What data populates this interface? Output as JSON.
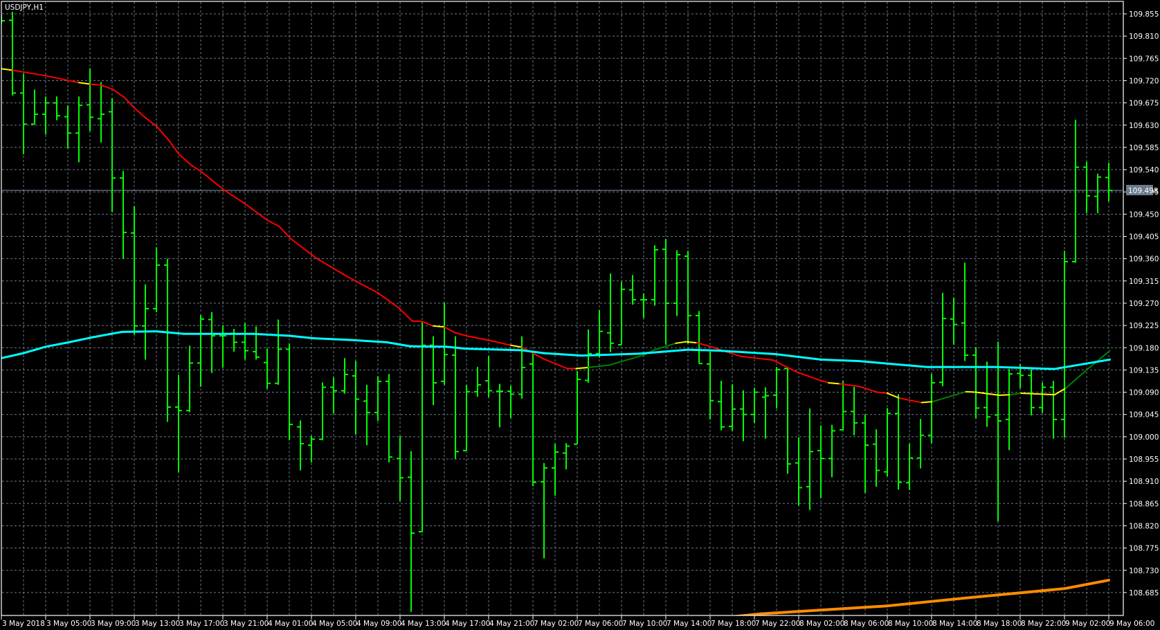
{
  "chart_data": {
    "type": "ohlc",
    "title": "USDJPY,H1",
    "symbol": "USDJPY",
    "timeframe": "H1",
    "current_price": "109.498",
    "ylim": [
      108.64,
      109.88
    ],
    "grid": true,
    "price_labels": [
      "109.855",
      "109.810",
      "109.765",
      "109.720",
      "109.675",
      "109.630",
      "109.585",
      "109.540",
      "109.495",
      "109.450",
      "109.405",
      "109.360",
      "109.315",
      "109.270",
      "109.225",
      "109.180",
      "109.135",
      "109.090",
      "109.045",
      "109.000",
      "108.955",
      "108.910",
      "108.865",
      "108.820",
      "108.775",
      "108.730",
      "108.685"
    ],
    "time_labels": [
      "3 May 2018",
      "3 May 05:00",
      "3 May 09:00",
      "3 May 13:00",
      "3 May 17:00",
      "3 May 21:00",
      "4 May 01:00",
      "4 May 05:00",
      "4 May 09:00",
      "4 May 13:00",
      "4 May 17:00",
      "4 May 21:00",
      "7 May 02:00",
      "7 May 06:00",
      "7 May 10:00",
      "7 May 14:00",
      "7 May 18:00",
      "7 May 22:00",
      "8 May 02:00",
      "8 May 06:00",
      "8 May 10:00",
      "8 May 14:00",
      "8 May 18:00",
      "8 May 22:00",
      "9 May 02:00",
      "9 May 06:00"
    ],
    "bars_ohlc": [
      [
        109.845,
        109.852,
        109.835,
        109.841
      ],
      [
        109.842,
        109.859,
        109.69,
        109.695
      ],
      [
        109.695,
        109.734,
        109.571,
        109.632
      ],
      [
        109.632,
        109.702,
        109.631,
        109.652
      ],
      [
        109.652,
        109.688,
        109.611,
        109.675
      ],
      [
        109.675,
        109.688,
        109.64,
        109.649
      ],
      [
        109.647,
        109.67,
        109.583,
        109.614
      ],
      [
        109.614,
        109.688,
        109.555,
        109.67
      ],
      [
        109.671,
        109.745,
        109.618,
        109.646
      ],
      [
        109.643,
        109.717,
        109.595,
        109.652
      ],
      [
        109.657,
        109.684,
        109.454,
        109.523
      ],
      [
        109.523,
        109.537,
        109.36,
        109.413
      ],
      [
        109.412,
        109.466,
        109.207,
        109.224
      ],
      [
        109.224,
        109.308,
        109.156,
        109.259
      ],
      [
        109.259,
        109.383,
        109.252,
        109.347
      ],
      [
        109.347,
        109.36,
        109.03,
        109.06
      ],
      [
        109.06,
        109.125,
        108.929,
        109.053
      ],
      [
        109.053,
        109.184,
        109.05,
        109.149
      ],
      [
        109.149,
        109.246,
        109.101,
        109.238
      ],
      [
        109.237,
        109.252,
        109.129,
        109.204
      ],
      [
        109.204,
        109.225,
        109.14,
        109.204
      ],
      [
        109.209,
        109.218,
        109.172,
        109.191
      ],
      [
        109.191,
        109.23,
        109.156,
        109.174
      ],
      [
        109.172,
        109.223,
        109.156,
        109.161
      ],
      [
        109.15,
        109.178,
        109.097,
        109.108
      ],
      [
        109.108,
        109.237,
        109.105,
        109.177
      ],
      [
        109.177,
        109.188,
        108.993,
        109.025
      ],
      [
        109.02,
        109.033,
        108.932,
        108.986
      ],
      [
        108.983,
        109.002,
        108.948,
        108.995
      ],
      [
        108.995,
        109.11,
        108.993,
        109.1
      ],
      [
        109.1,
        109.12,
        109.047,
        109.093
      ],
      [
        109.093,
        109.159,
        109.087,
        109.126
      ],
      [
        109.123,
        109.153,
        109.005,
        109.076
      ],
      [
        109.072,
        109.105,
        108.983,
        109.049
      ],
      [
        109.049,
        109.122,
        109.032,
        109.112
      ],
      [
        109.112,
        109.127,
        108.948,
        108.959
      ],
      [
        108.956,
        109.001,
        108.87,
        108.917
      ],
      [
        108.918,
        108.971,
        108.646,
        108.805
      ],
      [
        108.808,
        109.231,
        108.807,
        109.185
      ],
      [
        109.185,
        109.203,
        109.064,
        109.109
      ],
      [
        109.112,
        109.271,
        109.105,
        109.166
      ],
      [
        109.165,
        109.203,
        108.955,
        108.97
      ],
      [
        108.972,
        109.105,
        108.972,
        109.091
      ],
      [
        109.091,
        109.141,
        109.081,
        109.105
      ],
      [
        109.113,
        109.163,
        109.08,
        109.093
      ],
      [
        109.092,
        109.107,
        109.019,
        109.092
      ],
      [
        109.092,
        109.103,
        109.038,
        109.086
      ],
      [
        109.086,
        109.203,
        109.077,
        109.14
      ],
      [
        109.147,
        109.169,
        108.9,
        108.908
      ],
      [
        108.909,
        108.947,
        108.754,
        108.937
      ],
      [
        108.937,
        108.986,
        108.881,
        108.969
      ],
      [
        108.967,
        108.987,
        108.934,
        108.981
      ],
      [
        108.985,
        109.133,
        108.985,
        109.116
      ],
      [
        109.114,
        109.217,
        109.109,
        109.168
      ],
      [
        109.168,
        109.256,
        109.16,
        109.213
      ],
      [
        109.21,
        109.33,
        109.171,
        109.189
      ],
      [
        109.186,
        109.313,
        109.186,
        109.298
      ],
      [
        109.297,
        109.327,
        109.267,
        109.277
      ],
      [
        109.277,
        109.289,
        109.24,
        109.277
      ],
      [
        109.277,
        109.387,
        109.265,
        109.378
      ],
      [
        109.379,
        109.4,
        109.186,
        109.27
      ],
      [
        109.27,
        109.377,
        109.244,
        109.368
      ],
      [
        109.365,
        109.376,
        109.188,
        109.245
      ],
      [
        109.245,
        109.254,
        109.148,
        109.148
      ],
      [
        109.147,
        109.172,
        109.035,
        109.073
      ],
      [
        109.071,
        109.113,
        109.013,
        109.02
      ],
      [
        109.021,
        109.106,
        109.012,
        109.056
      ],
      [
        109.056,
        109.094,
        108.991,
        109.045
      ],
      [
        109.045,
        109.099,
        109.028,
        109.09
      ],
      [
        109.08,
        109.1,
        108.996,
        109.083
      ],
      [
        109.084,
        109.141,
        109.057,
        109.136
      ],
      [
        109.138,
        109.138,
        108.925,
        108.945
      ],
      [
        108.947,
        108.999,
        108.861,
        108.897
      ],
      [
        108.899,
        109.057,
        108.852,
        108.97
      ],
      [
        108.972,
        109.023,
        108.876,
        108.956
      ],
      [
        108.956,
        109.024,
        108.918,
        109.012
      ],
      [
        109.014,
        109.113,
        109.013,
        109.051
      ],
      [
        109.051,
        109.101,
        109.003,
        109.028
      ],
      [
        109.028,
        109.045,
        108.887,
        108.983
      ],
      [
        108.985,
        109.015,
        108.899,
        108.932
      ],
      [
        108.929,
        109.058,
        108.92,
        109.047
      ],
      [
        109.047,
        109.086,
        108.893,
        108.908
      ],
      [
        108.907,
        108.986,
        108.892,
        108.957
      ],
      [
        108.957,
        109.036,
        108.936,
        109.003
      ],
      [
        109.003,
        109.127,
        108.987,
        109.109
      ],
      [
        109.11,
        109.291,
        109.102,
        109.239
      ],
      [
        109.238,
        109.281,
        109.186,
        109.227
      ],
      [
        109.23,
        109.352,
        109.153,
        109.165
      ],
      [
        109.165,
        109.181,
        109.037,
        109.058
      ],
      [
        109.059,
        109.152,
        109.02,
        109.04
      ],
      [
        109.044,
        109.192,
        108.829,
        109.032
      ],
      [
        109.035,
        109.137,
        108.973,
        109.127
      ],
      [
        109.128,
        109.147,
        109.098,
        109.124
      ],
      [
        109.124,
        109.136,
        109.043,
        109.059
      ],
      [
        109.059,
        109.11,
        109.048,
        109.1
      ],
      [
        109.1,
        109.113,
        108.996,
        109.035
      ],
      [
        109.035,
        109.376,
        108.998,
        109.354
      ],
      [
        109.354,
        109.641,
        109.352,
        109.545
      ],
      [
        109.545,
        109.556,
        109.452,
        109.487
      ],
      [
        109.486,
        109.532,
        109.452,
        109.525
      ],
      [
        109.524,
        109.554,
        109.476,
        109.498
      ]
    ],
    "indicators": [
      {
        "name": "color-ma",
        "colors": {
          "red": "#ff0000",
          "yellow": "#ffff00",
          "green": "#008000"
        },
        "color_ranges": [
          [
            0,
            1,
            "yellow"
          ],
          [
            1,
            7,
            "red"
          ],
          [
            7,
            8,
            "yellow"
          ],
          [
            8,
            39,
            "red"
          ],
          [
            39,
            40,
            "yellow"
          ],
          [
            40,
            46,
            "red"
          ],
          [
            46,
            47,
            "yellow"
          ],
          [
            47,
            51.9,
            "red"
          ],
          [
            51.9,
            53,
            "yellow"
          ],
          [
            53,
            60.9,
            "green"
          ],
          [
            60.9,
            62.8,
            "yellow"
          ],
          [
            62.8,
            74.7,
            "red"
          ],
          [
            74.7,
            75.7,
            "yellow"
          ],
          [
            75.7,
            80,
            "red"
          ],
          [
            80,
            81.1,
            "yellow"
          ],
          [
            81.1,
            83.1,
            "red"
          ],
          [
            83.1,
            84.1,
            "yellow"
          ],
          [
            84.1,
            87.1,
            "green"
          ],
          [
            87.1,
            91.1,
            "yellow"
          ],
          [
            91.1,
            92.1,
            "green"
          ],
          [
            92.1,
            96.1,
            "yellow"
          ],
          [
            96.1,
            101,
            "green"
          ]
        ],
        "points": [
          [
            0,
            109.744
          ],
          [
            1,
            109.741
          ],
          [
            4,
            109.73
          ],
          [
            6.1,
            109.72
          ],
          [
            7,
            109.716
          ],
          [
            8,
            109.713
          ],
          [
            9,
            109.711
          ],
          [
            10.1,
            109.702
          ],
          [
            11.1,
            109.686
          ],
          [
            12,
            109.665
          ],
          [
            13,
            109.645
          ],
          [
            14,
            109.628
          ],
          [
            15.1,
            109.6
          ],
          [
            16,
            109.572
          ],
          [
            17.2,
            109.548
          ],
          [
            18,
            109.537
          ],
          [
            20.1,
            109.499
          ],
          [
            22,
            109.471
          ],
          [
            24,
            109.438
          ],
          [
            25.1,
            109.425
          ],
          [
            26.1,
            109.401
          ],
          [
            28.5,
            109.36
          ],
          [
            31.3,
            109.323
          ],
          [
            34,
            109.291
          ],
          [
            35.9,
            109.26
          ],
          [
            37.1,
            109.234
          ],
          [
            38,
            109.233
          ],
          [
            39,
            109.224
          ],
          [
            40,
            109.222
          ],
          [
            40.9,
            109.211
          ],
          [
            42,
            109.204
          ],
          [
            44,
            109.195
          ],
          [
            46,
            109.185
          ],
          [
            47,
            109.181
          ],
          [
            48,
            109.169
          ],
          [
            49,
            109.157
          ],
          [
            51.1,
            109.138
          ],
          [
            51.9,
            109.138
          ],
          [
            53,
            109.14
          ],
          [
            54.9,
            109.145
          ],
          [
            58,
            109.165
          ],
          [
            59,
            109.176
          ],
          [
            60.9,
            109.189
          ],
          [
            61.8,
            109.192
          ],
          [
            62.8,
            109.19
          ],
          [
            63.8,
            109.184
          ],
          [
            66.7,
            109.163
          ],
          [
            68.8,
            109.157
          ],
          [
            69.7,
            109.155
          ],
          [
            71.7,
            109.132
          ],
          [
            73.8,
            109.115
          ],
          [
            74.7,
            109.109
          ],
          [
            75.7,
            109.107
          ],
          [
            77.4,
            109.102
          ],
          [
            79.1,
            109.09
          ],
          [
            80,
            109.088
          ],
          [
            81.1,
            109.078
          ],
          [
            83.1,
            109.069
          ],
          [
            84.1,
            109.071
          ],
          [
            87.1,
            109.091
          ],
          [
            88,
            109.09
          ],
          [
            90.1,
            109.084
          ],
          [
            91.1,
            109.085
          ],
          [
            92.1,
            109.088
          ],
          [
            95.1,
            109.085
          ],
          [
            96.1,
            109.098
          ],
          [
            98.1,
            109.137
          ],
          [
            100.1,
            109.174
          ]
        ]
      },
      {
        "name": "cyan-ma",
        "color": "#00ffff",
        "points": [
          [
            0,
            109.159
          ],
          [
            2,
            109.169
          ],
          [
            4,
            109.182
          ],
          [
            6.1,
            109.191
          ],
          [
            8.2,
            109.201
          ],
          [
            9.9,
            109.208
          ],
          [
            10.9,
            109.212
          ],
          [
            14,
            109.213
          ],
          [
            16.5,
            109.208
          ],
          [
            22.8,
            109.208
          ],
          [
            26.1,
            109.204
          ],
          [
            28.2,
            109.199
          ],
          [
            31.3,
            109.196
          ],
          [
            34.8,
            109.191
          ],
          [
            36.9,
            109.183
          ],
          [
            40.2,
            109.182
          ],
          [
            41.9,
            109.178
          ],
          [
            46.9,
            109.175
          ],
          [
            49,
            109.169
          ],
          [
            52.4,
            109.164
          ],
          [
            57.6,
            109.168
          ],
          [
            62,
            109.176
          ],
          [
            64.8,
            109.174
          ],
          [
            69.9,
            109.167
          ],
          [
            74,
            109.156
          ],
          [
            77.4,
            109.153
          ],
          [
            83.6,
            109.141
          ],
          [
            89.9,
            109.141
          ],
          [
            95.1,
            109.137
          ],
          [
            100.1,
            109.156
          ]
        ]
      },
      {
        "name": "orange-ma",
        "color": "#ff8c00",
        "points": [
          [
            66,
            108.636
          ],
          [
            68.6,
            108.642
          ],
          [
            80,
            108.658
          ],
          [
            88,
            108.676
          ],
          [
            92.3,
            108.685
          ],
          [
            96,
            108.693
          ],
          [
            100,
            108.71
          ]
        ]
      }
    ],
    "colors": {
      "bars": "#00ff00",
      "grid": "#6c7a8c",
      "frame": "#ffffff",
      "current_price_bg": "#6b7b8c",
      "current_price_line": "#8a97a6"
    }
  }
}
